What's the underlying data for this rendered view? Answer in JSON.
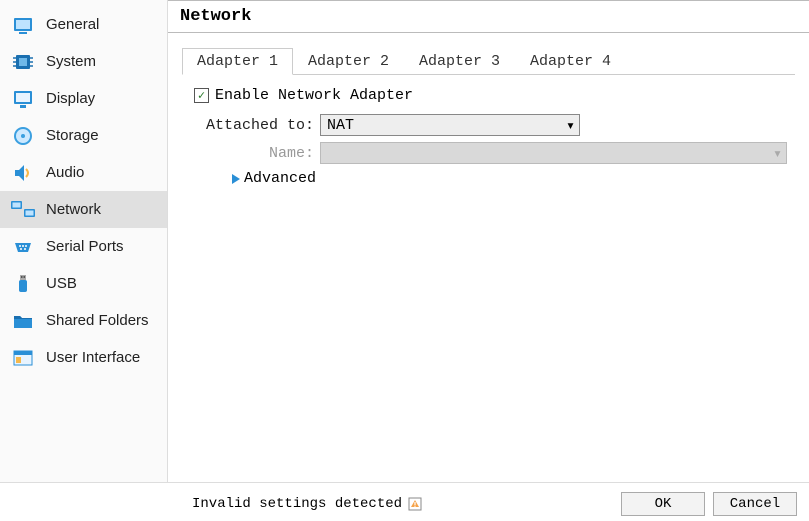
{
  "title": "Network",
  "sidebar": {
    "items": [
      {
        "label": "General"
      },
      {
        "label": "System"
      },
      {
        "label": "Display"
      },
      {
        "label": "Storage"
      },
      {
        "label": "Audio"
      },
      {
        "label": "Network",
        "active": true
      },
      {
        "label": "Serial Ports"
      },
      {
        "label": "USB"
      },
      {
        "label": "Shared Folders"
      },
      {
        "label": "User Interface"
      }
    ]
  },
  "tabs": [
    {
      "label": "Adapter 1",
      "active": true
    },
    {
      "label": "Adapter 2"
    },
    {
      "label": "Adapter 3"
    },
    {
      "label": "Adapter 4"
    }
  ],
  "enable_label": "Enable Network Adapter",
  "enable_checked": true,
  "attached_label": "Attached to:",
  "attached_value": "NAT",
  "name_label": "Name:",
  "name_value": "",
  "advanced_label": "Advanced",
  "status_message": "Invalid settings detected",
  "buttons": {
    "ok": "OK",
    "cancel": "Cancel"
  }
}
